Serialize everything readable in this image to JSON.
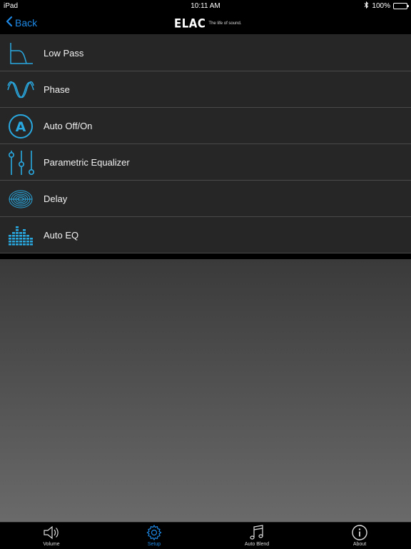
{
  "status_bar": {
    "device": "iPad",
    "time": "10:11 AM",
    "battery": "100%"
  },
  "nav": {
    "back_label": "Back",
    "logo_text": "ELAC",
    "logo_tagline": "The life of sound."
  },
  "settings": [
    {
      "label": "Low Pass",
      "icon": "low-pass-icon"
    },
    {
      "label": "Phase",
      "icon": "phase-icon"
    },
    {
      "label": "Auto Off/On",
      "icon": "auto-icon"
    },
    {
      "label": "Parametric Equalizer",
      "icon": "equalizer-sliders-icon"
    },
    {
      "label": "Delay",
      "icon": "delay-icon"
    },
    {
      "label": "Auto EQ",
      "icon": "auto-eq-icon"
    }
  ],
  "tabs": [
    {
      "label": "Volume",
      "icon": "speaker-icon"
    },
    {
      "label": "Setup",
      "icon": "gear-icon",
      "active": true
    },
    {
      "label": "Auto Blend",
      "icon": "music-note-icon"
    },
    {
      "label": "About",
      "icon": "info-icon"
    }
  ],
  "colors": {
    "accent": "#1e88e5",
    "icon_blue": "#29a8e0",
    "row_bg": "#262626"
  }
}
